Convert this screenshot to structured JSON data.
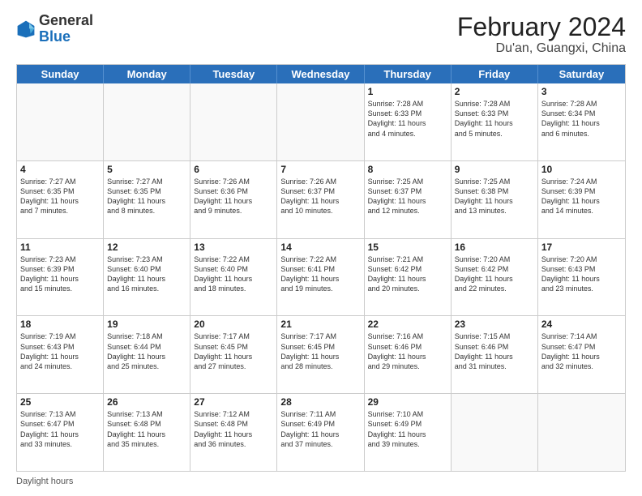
{
  "header": {
    "logo": {
      "general": "General",
      "blue": "Blue"
    },
    "title": "February 2024",
    "subtitle": "Du'an, Guangxi, China"
  },
  "weekdays": [
    "Sunday",
    "Monday",
    "Tuesday",
    "Wednesday",
    "Thursday",
    "Friday",
    "Saturday"
  ],
  "rows": [
    [
      {
        "day": "",
        "text": ""
      },
      {
        "day": "",
        "text": ""
      },
      {
        "day": "",
        "text": ""
      },
      {
        "day": "",
        "text": ""
      },
      {
        "day": "1",
        "text": "Sunrise: 7:28 AM\nSunset: 6:33 PM\nDaylight: 11 hours\nand 4 minutes."
      },
      {
        "day": "2",
        "text": "Sunrise: 7:28 AM\nSunset: 6:33 PM\nDaylight: 11 hours\nand 5 minutes."
      },
      {
        "day": "3",
        "text": "Sunrise: 7:28 AM\nSunset: 6:34 PM\nDaylight: 11 hours\nand 6 minutes."
      }
    ],
    [
      {
        "day": "4",
        "text": "Sunrise: 7:27 AM\nSunset: 6:35 PM\nDaylight: 11 hours\nand 7 minutes."
      },
      {
        "day": "5",
        "text": "Sunrise: 7:27 AM\nSunset: 6:35 PM\nDaylight: 11 hours\nand 8 minutes."
      },
      {
        "day": "6",
        "text": "Sunrise: 7:26 AM\nSunset: 6:36 PM\nDaylight: 11 hours\nand 9 minutes."
      },
      {
        "day": "7",
        "text": "Sunrise: 7:26 AM\nSunset: 6:37 PM\nDaylight: 11 hours\nand 10 minutes."
      },
      {
        "day": "8",
        "text": "Sunrise: 7:25 AM\nSunset: 6:37 PM\nDaylight: 11 hours\nand 12 minutes."
      },
      {
        "day": "9",
        "text": "Sunrise: 7:25 AM\nSunset: 6:38 PM\nDaylight: 11 hours\nand 13 minutes."
      },
      {
        "day": "10",
        "text": "Sunrise: 7:24 AM\nSunset: 6:39 PM\nDaylight: 11 hours\nand 14 minutes."
      }
    ],
    [
      {
        "day": "11",
        "text": "Sunrise: 7:23 AM\nSunset: 6:39 PM\nDaylight: 11 hours\nand 15 minutes."
      },
      {
        "day": "12",
        "text": "Sunrise: 7:23 AM\nSunset: 6:40 PM\nDaylight: 11 hours\nand 16 minutes."
      },
      {
        "day": "13",
        "text": "Sunrise: 7:22 AM\nSunset: 6:40 PM\nDaylight: 11 hours\nand 18 minutes."
      },
      {
        "day": "14",
        "text": "Sunrise: 7:22 AM\nSunset: 6:41 PM\nDaylight: 11 hours\nand 19 minutes."
      },
      {
        "day": "15",
        "text": "Sunrise: 7:21 AM\nSunset: 6:42 PM\nDaylight: 11 hours\nand 20 minutes."
      },
      {
        "day": "16",
        "text": "Sunrise: 7:20 AM\nSunset: 6:42 PM\nDaylight: 11 hours\nand 22 minutes."
      },
      {
        "day": "17",
        "text": "Sunrise: 7:20 AM\nSunset: 6:43 PM\nDaylight: 11 hours\nand 23 minutes."
      }
    ],
    [
      {
        "day": "18",
        "text": "Sunrise: 7:19 AM\nSunset: 6:43 PM\nDaylight: 11 hours\nand 24 minutes."
      },
      {
        "day": "19",
        "text": "Sunrise: 7:18 AM\nSunset: 6:44 PM\nDaylight: 11 hours\nand 25 minutes."
      },
      {
        "day": "20",
        "text": "Sunrise: 7:17 AM\nSunset: 6:45 PM\nDaylight: 11 hours\nand 27 minutes."
      },
      {
        "day": "21",
        "text": "Sunrise: 7:17 AM\nSunset: 6:45 PM\nDaylight: 11 hours\nand 28 minutes."
      },
      {
        "day": "22",
        "text": "Sunrise: 7:16 AM\nSunset: 6:46 PM\nDaylight: 11 hours\nand 29 minutes."
      },
      {
        "day": "23",
        "text": "Sunrise: 7:15 AM\nSunset: 6:46 PM\nDaylight: 11 hours\nand 31 minutes."
      },
      {
        "day": "24",
        "text": "Sunrise: 7:14 AM\nSunset: 6:47 PM\nDaylight: 11 hours\nand 32 minutes."
      }
    ],
    [
      {
        "day": "25",
        "text": "Sunrise: 7:13 AM\nSunset: 6:47 PM\nDaylight: 11 hours\nand 33 minutes."
      },
      {
        "day": "26",
        "text": "Sunrise: 7:13 AM\nSunset: 6:48 PM\nDaylight: 11 hours\nand 35 minutes."
      },
      {
        "day": "27",
        "text": "Sunrise: 7:12 AM\nSunset: 6:48 PM\nDaylight: 11 hours\nand 36 minutes."
      },
      {
        "day": "28",
        "text": "Sunrise: 7:11 AM\nSunset: 6:49 PM\nDaylight: 11 hours\nand 37 minutes."
      },
      {
        "day": "29",
        "text": "Sunrise: 7:10 AM\nSunset: 6:49 PM\nDaylight: 11 hours\nand 39 minutes."
      },
      {
        "day": "",
        "text": ""
      },
      {
        "day": "",
        "text": ""
      }
    ]
  ],
  "footer": {
    "daylight_label": "Daylight hours"
  }
}
